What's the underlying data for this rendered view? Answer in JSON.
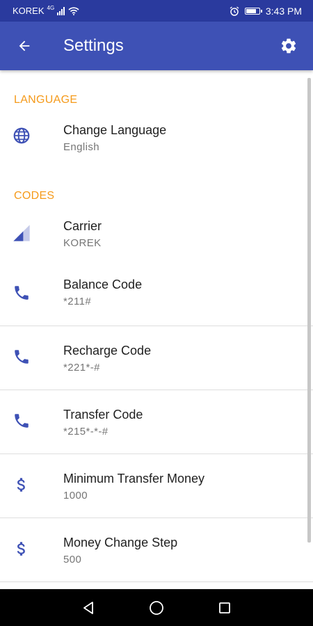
{
  "status_bar": {
    "carrier": "KOREK",
    "network_type": "4G",
    "time": "3:43 PM",
    "icons": [
      "signal-icon",
      "wifi-icon",
      "alarm-icon",
      "battery-icon"
    ]
  },
  "app_bar": {
    "title": "Settings",
    "back_icon": "arrow-back-icon",
    "settings_icon": "gear-icon",
    "color": "#3e51b5"
  },
  "sections": [
    {
      "header": "LANGUAGE",
      "items": [
        {
          "icon": "globe-icon",
          "title": "Change Language",
          "value": "English"
        }
      ]
    },
    {
      "header": "CODES",
      "items": [
        {
          "icon": "signal-icon",
          "title": "Carrier",
          "value": "KOREK"
        },
        {
          "icon": "phone-icon",
          "title": "Balance Code",
          "value": "*211#"
        },
        {
          "icon": "phone-icon",
          "title": "Recharge Code",
          "value": "*221*-#"
        },
        {
          "icon": "phone-icon",
          "title": "Transfer Code",
          "value": "*215*-*-#"
        },
        {
          "icon": "dollar-icon",
          "title": "Minimum Transfer Money",
          "value": "1000"
        },
        {
          "icon": "dollar-icon",
          "title": "Money Change Step",
          "value": "500"
        }
      ]
    }
  ],
  "nav_bar": {
    "icons": [
      "back-triangle-icon",
      "home-circle-icon",
      "recents-square-icon"
    ]
  },
  "colors": {
    "accent": "#f59a1a",
    "primary": "#3e51b5",
    "primary_dark": "#2a3a9e"
  }
}
